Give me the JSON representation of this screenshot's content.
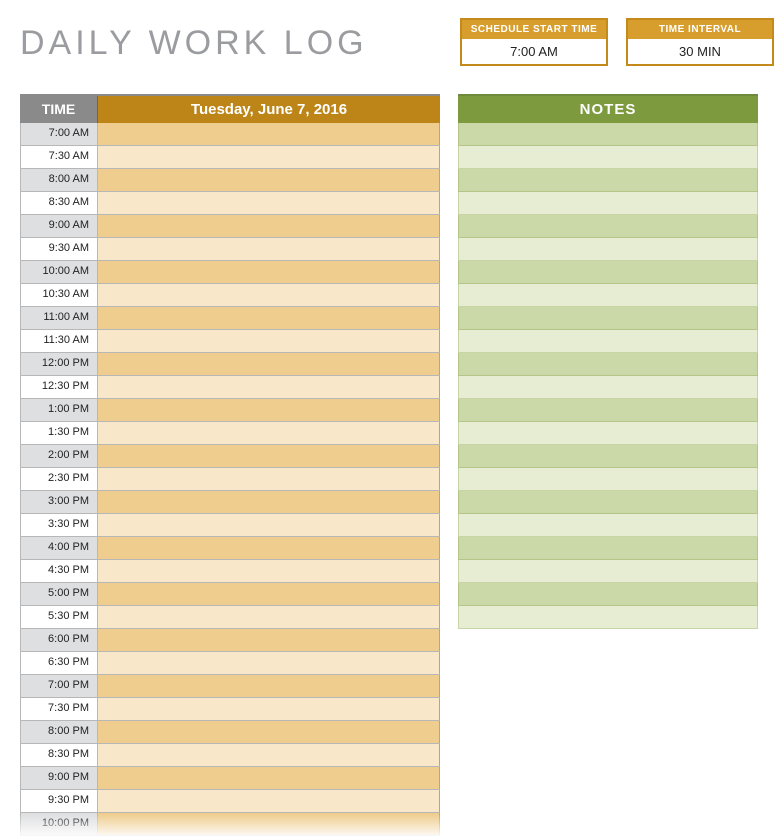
{
  "title": "DAILY WORK LOG",
  "config": {
    "start_time": {
      "label": "SCHEDULE START TIME",
      "value": "7:00 AM"
    },
    "interval": {
      "label": "TIME INTERVAL",
      "value": "30 MIN"
    }
  },
  "schedule": {
    "time_header": "TIME",
    "date_header": "Tuesday, June 7, 2016",
    "rows": [
      {
        "time": "7:00 AM",
        "entry": ""
      },
      {
        "time": "7:30 AM",
        "entry": ""
      },
      {
        "time": "8:00 AM",
        "entry": ""
      },
      {
        "time": "8:30 AM",
        "entry": ""
      },
      {
        "time": "9:00 AM",
        "entry": ""
      },
      {
        "time": "9:30 AM",
        "entry": ""
      },
      {
        "time": "10:00 AM",
        "entry": ""
      },
      {
        "time": "10:30 AM",
        "entry": ""
      },
      {
        "time": "11:00 AM",
        "entry": ""
      },
      {
        "time": "11:30 AM",
        "entry": ""
      },
      {
        "time": "12:00 PM",
        "entry": ""
      },
      {
        "time": "12:30 PM",
        "entry": ""
      },
      {
        "time": "1:00 PM",
        "entry": ""
      },
      {
        "time": "1:30 PM",
        "entry": ""
      },
      {
        "time": "2:00 PM",
        "entry": ""
      },
      {
        "time": "2:30 PM",
        "entry": ""
      },
      {
        "time": "3:00 PM",
        "entry": ""
      },
      {
        "time": "3:30 PM",
        "entry": ""
      },
      {
        "time": "4:00 PM",
        "entry": ""
      },
      {
        "time": "4:30 PM",
        "entry": ""
      },
      {
        "time": "5:00 PM",
        "entry": ""
      },
      {
        "time": "5:30 PM",
        "entry": ""
      },
      {
        "time": "6:00 PM",
        "entry": ""
      },
      {
        "time": "6:30 PM",
        "entry": ""
      },
      {
        "time": "7:00 PM",
        "entry": ""
      },
      {
        "time": "7:30 PM",
        "entry": ""
      },
      {
        "time": "8:00 PM",
        "entry": ""
      },
      {
        "time": "8:30 PM",
        "entry": ""
      },
      {
        "time": "9:00 PM",
        "entry": ""
      },
      {
        "time": "9:30 PM",
        "entry": ""
      },
      {
        "time": "10:00 PM",
        "entry": ""
      }
    ]
  },
  "notes": {
    "header": "NOTES",
    "rows_count": 22
  }
}
